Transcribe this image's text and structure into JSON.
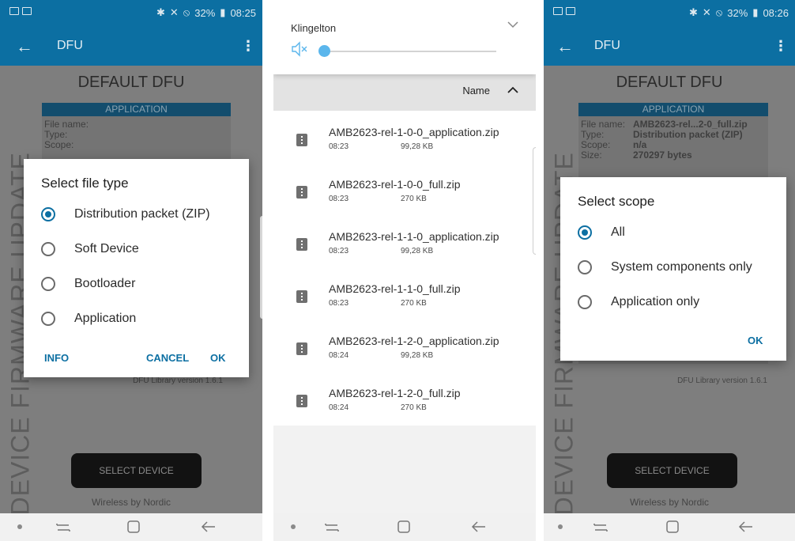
{
  "colors": {
    "accent": "#0c6fa2",
    "scrim": "#7e7e7e",
    "dialog": "#ffffff",
    "button_dark": "#121212"
  },
  "status_left": {
    "time": "08:25",
    "battery": "32%"
  },
  "status_right": {
    "time": "08:26",
    "battery": "32%"
  },
  "app": {
    "title": "DFU",
    "heading": "DEFAULT DFU",
    "vertical_title": "DEVICE FIRMWARE UPDATE",
    "application_header": "APPLICATION",
    "file_name_label": "File name:",
    "type_label": "Type:",
    "scope_label": "Scope:",
    "size_label": "Size:",
    "library_version": "DFU Library version 1.6.1",
    "select_device": "SELECT DEVICE",
    "footer": "Wireless by Nordic"
  },
  "app_right_values": {
    "file_name": "AMB2623-rel...2-0_full.zip",
    "type": "Distribution packet (ZIP)",
    "scope": "n/a",
    "size": "270297 bytes"
  },
  "file_type_dialog": {
    "title": "Select file type",
    "options": [
      "Distribution packet (ZIP)",
      "Soft Device",
      "Bootloader",
      "Application"
    ],
    "selected": "Distribution packet (ZIP)",
    "info": "INFO",
    "cancel": "CANCEL",
    "ok": "OK"
  },
  "scope_dialog": {
    "title": "Select scope",
    "options": [
      "All",
      "System components only",
      "Application only"
    ],
    "selected": "All",
    "ok": "OK"
  },
  "volume_panel": {
    "label": "Klingelton",
    "level_fraction": 0.0,
    "icon": "volume-muted-icon"
  },
  "file_picker": {
    "sort_label": "Name",
    "files": [
      {
        "name": "AMB2623-rel-1-0-0_application.zip",
        "time": "08:23",
        "size": "99,28 KB"
      },
      {
        "name": "AMB2623-rel-1-0-0_full.zip",
        "time": "08:23",
        "size": "270 KB"
      },
      {
        "name": "AMB2623-rel-1-1-0_application.zip",
        "time": "08:23",
        "size": "99,28 KB"
      },
      {
        "name": "AMB2623-rel-1-1-0_full.zip",
        "time": "08:23",
        "size": "270 KB"
      },
      {
        "name": "AMB2623-rel-1-2-0_application.zip",
        "time": "08:24",
        "size": "99,28 KB"
      },
      {
        "name": "AMB2623-rel-1-2-0_full.zip",
        "time": "08:24",
        "size": "270 KB"
      }
    ]
  }
}
